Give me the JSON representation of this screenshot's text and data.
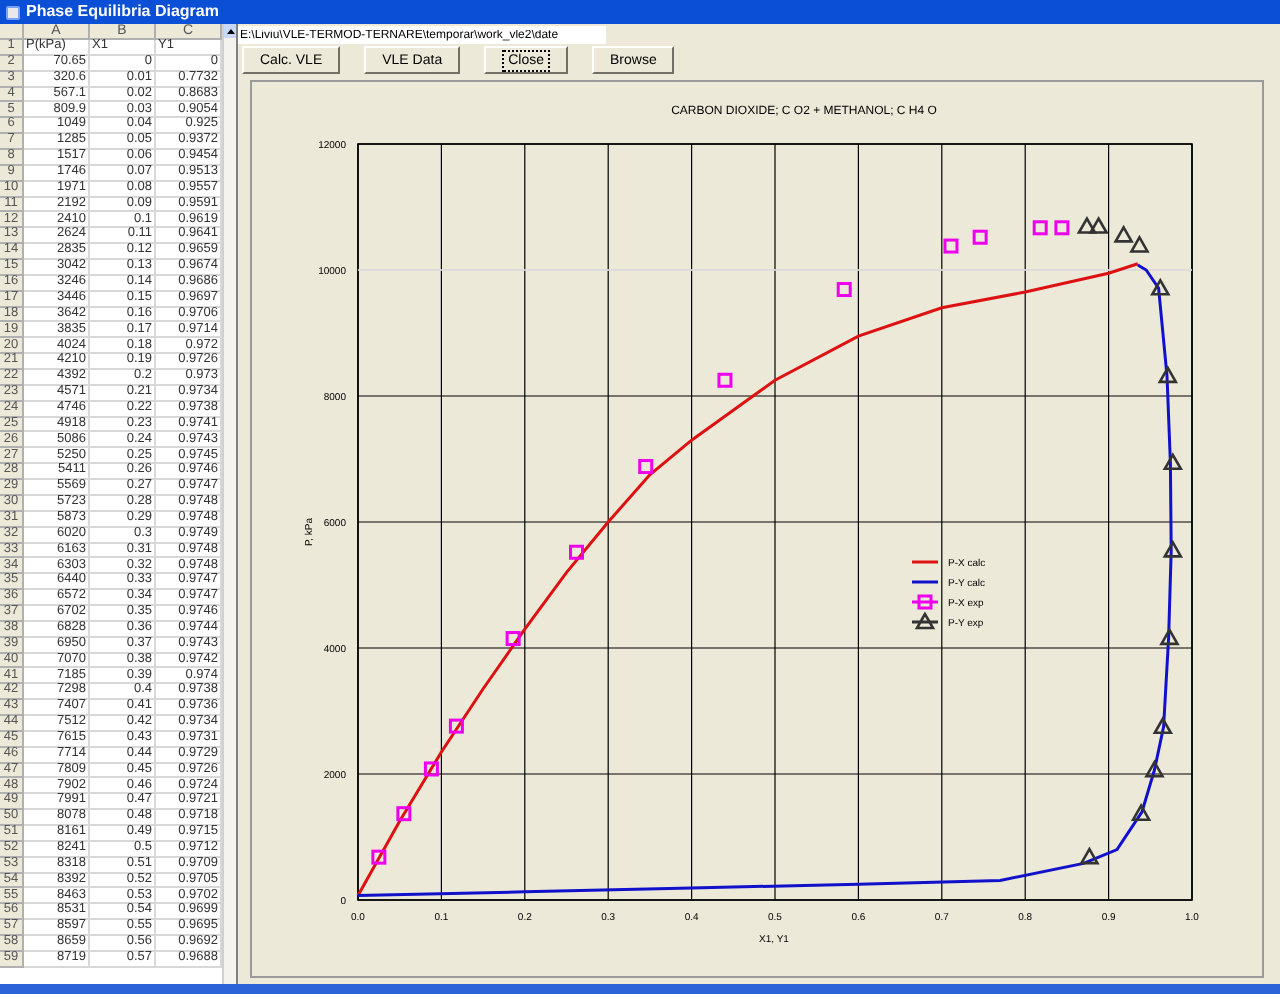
{
  "window": {
    "title": "Phase Equilibria Diagram"
  },
  "sheet": {
    "columns": [
      "",
      "A",
      "B",
      "C"
    ],
    "rows": [
      [
        "1",
        "P(kPa)",
        "X1",
        "Y1"
      ],
      [
        "2",
        "70.65",
        "0",
        "0"
      ],
      [
        "3",
        "320.6",
        "0.01",
        "0.7732"
      ],
      [
        "4",
        "567.1",
        "0.02",
        "0.8683"
      ],
      [
        "5",
        "809.9",
        "0.03",
        "0.9054"
      ],
      [
        "6",
        "1049",
        "0.04",
        "0.925"
      ],
      [
        "7",
        "1285",
        "0.05",
        "0.9372"
      ],
      [
        "8",
        "1517",
        "0.06",
        "0.9454"
      ],
      [
        "9",
        "1746",
        "0.07",
        "0.9513"
      ],
      [
        "10",
        "1971",
        "0.08",
        "0.9557"
      ],
      [
        "11",
        "2192",
        "0.09",
        "0.9591"
      ],
      [
        "12",
        "2410",
        "0.1",
        "0.9619"
      ],
      [
        "13",
        "2624",
        "0.11",
        "0.9641"
      ],
      [
        "14",
        "2835",
        "0.12",
        "0.9659"
      ],
      [
        "15",
        "3042",
        "0.13",
        "0.9674"
      ],
      [
        "16",
        "3246",
        "0.14",
        "0.9686"
      ],
      [
        "17",
        "3446",
        "0.15",
        "0.9697"
      ],
      [
        "18",
        "3642",
        "0.16",
        "0.9706"
      ],
      [
        "19",
        "3835",
        "0.17",
        "0.9714"
      ],
      [
        "20",
        "4024",
        "0.18",
        "0.972"
      ],
      [
        "21",
        "4210",
        "0.19",
        "0.9726"
      ],
      [
        "22",
        "4392",
        "0.2",
        "0.973"
      ],
      [
        "23",
        "4571",
        "0.21",
        "0.9734"
      ],
      [
        "24",
        "4746",
        "0.22",
        "0.9738"
      ],
      [
        "25",
        "4918",
        "0.23",
        "0.9741"
      ],
      [
        "26",
        "5086",
        "0.24",
        "0.9743"
      ],
      [
        "27",
        "5250",
        "0.25",
        "0.9745"
      ],
      [
        "28",
        "5411",
        "0.26",
        "0.9746"
      ],
      [
        "29",
        "5569",
        "0.27",
        "0.9747"
      ],
      [
        "30",
        "5723",
        "0.28",
        "0.9748"
      ],
      [
        "31",
        "5873",
        "0.29",
        "0.9748"
      ],
      [
        "32",
        "6020",
        "0.3",
        "0.9749"
      ],
      [
        "33",
        "6163",
        "0.31",
        "0.9748"
      ],
      [
        "34",
        "6303",
        "0.32",
        "0.9748"
      ],
      [
        "35",
        "6440",
        "0.33",
        "0.9747"
      ],
      [
        "36",
        "6572",
        "0.34",
        "0.9747"
      ],
      [
        "37",
        "6702",
        "0.35",
        "0.9746"
      ],
      [
        "38",
        "6828",
        "0.36",
        "0.9744"
      ],
      [
        "39",
        "6950",
        "0.37",
        "0.9743"
      ],
      [
        "40",
        "7070",
        "0.38",
        "0.9742"
      ],
      [
        "41",
        "7185",
        "0.39",
        "0.974"
      ],
      [
        "42",
        "7298",
        "0.4",
        "0.9738"
      ],
      [
        "43",
        "7407",
        "0.41",
        "0.9736"
      ],
      [
        "44",
        "7512",
        "0.42",
        "0.9734"
      ],
      [
        "45",
        "7615",
        "0.43",
        "0.9731"
      ],
      [
        "46",
        "7714",
        "0.44",
        "0.9729"
      ],
      [
        "47",
        "7809",
        "0.45",
        "0.9726"
      ],
      [
        "48",
        "7902",
        "0.46",
        "0.9724"
      ],
      [
        "49",
        "7991",
        "0.47",
        "0.9721"
      ],
      [
        "50",
        "8078",
        "0.48",
        "0.9718"
      ],
      [
        "51",
        "8161",
        "0.49",
        "0.9715"
      ],
      [
        "52",
        "8241",
        "0.5",
        "0.9712"
      ],
      [
        "53",
        "8318",
        "0.51",
        "0.9709"
      ],
      [
        "54",
        "8392",
        "0.52",
        "0.9705"
      ],
      [
        "55",
        "8463",
        "0.53",
        "0.9702"
      ],
      [
        "56",
        "8531",
        "0.54",
        "0.9699"
      ],
      [
        "57",
        "8597",
        "0.55",
        "0.9695"
      ],
      [
        "58",
        "8659",
        "0.56",
        "0.9692"
      ],
      [
        "59",
        "8719",
        "0.57",
        "0.9688"
      ]
    ]
  },
  "path_field": {
    "value": "E:\\Liviu\\VLE-TERMOD-TERNARE\\temporar\\work_vle2\\date"
  },
  "buttons": [
    {
      "label": "Calc. VLE",
      "focused": false
    },
    {
      "label": "VLE Data",
      "focused": false
    },
    {
      "label": "Close",
      "focused": true
    },
    {
      "label": "Browse",
      "focused": false
    }
  ],
  "chart": {
    "chart_data": {
      "type": "line",
      "title": "CARBON DIOXIDE; C O2  +  METHANOL; C H4 O",
      "xlabel": "X1, Y1",
      "ylabel": "P, kPa",
      "xlim": [
        0,
        1
      ],
      "ylim": [
        0,
        12000
      ],
      "xticks": [
        {
          "value": 0,
          "label": "0.0"
        },
        0.1,
        0.2,
        0.3,
        0.4,
        0.5,
        0.6,
        0.7,
        0.8,
        0.9,
        {
          "value": 1,
          "label": "1.0"
        }
      ],
      "yticks": [
        0,
        2000,
        4000,
        6000,
        8000,
        10000,
        12000
      ],
      "grid": true,
      "legend": true,
      "ref_lines": [
        {
          "axis": "y",
          "value": 10000,
          "color": "#ffffff"
        }
      ],
      "series": [
        {
          "name": "P-X calc",
          "color": "#dd1111",
          "x": [
            0,
            0.05,
            0.1,
            0.15,
            0.2,
            0.25,
            0.3,
            0.35,
            0.4,
            0.5,
            0.6,
            0.7,
            0.8,
            0.9,
            0.935
          ],
          "values": [
            70,
            1250,
            2350,
            3350,
            4300,
            5200,
            6000,
            6750,
            7300,
            8250,
            8950,
            9400,
            9650,
            9950,
            10100
          ]
        },
        {
          "name": "P-Y calc",
          "color": "#1111cc",
          "x": [
            0,
            0.2,
            0.4,
            0.6,
            0.77,
            0.87,
            0.91,
            0.94,
            0.955,
            0.966,
            0.972,
            0.975,
            0.974,
            0.97,
            0.96,
            0.945,
            0.935
          ],
          "values": [
            70,
            130,
            190,
            250,
            310,
            580,
            800,
            1400,
            2060,
            2750,
            4160,
            5550,
            6940,
            8320,
            9710,
            10000,
            10080
          ]
        },
        {
          "name": "P-X exp",
          "type": "scatter",
          "marker": "square",
          "color": "#ee00ee",
          "x": [
            0.025,
            0.055,
            0.088,
            0.118,
            0.186,
            0.262,
            0.345,
            0.44,
            0.583,
            0.711,
            0.746,
            0.818,
            0.844
          ],
          "values": [
            680,
            1370,
            2080,
            2760,
            4150,
            5520,
            6880,
            8250,
            9690,
            10380,
            10520,
            10670,
            10670
          ]
        },
        {
          "name": "P-Y exp",
          "type": "scatter",
          "marker": "triangle",
          "color": "#333333",
          "x": [
            0.877,
            0.939,
            0.955,
            0.965,
            0.973,
            0.977,
            0.977,
            0.971,
            0.962,
            0.937,
            0.918,
            0.888,
            0.874
          ],
          "values": [
            680,
            1370,
            2060,
            2750,
            4160,
            5550,
            6940,
            8320,
            9710,
            10390,
            10550,
            10690,
            10690
          ]
        }
      ]
    }
  }
}
